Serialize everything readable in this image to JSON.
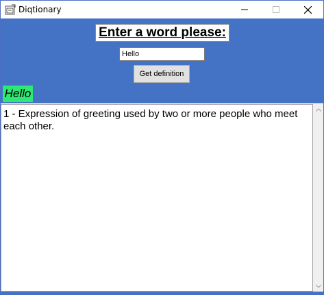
{
  "window": {
    "title": "Diqtionary",
    "icon": "app-icon"
  },
  "header": {
    "heading": "Enter a word please:"
  },
  "search": {
    "value": "Hello",
    "button_label": "Get definition"
  },
  "result": {
    "word": "Hello",
    "definition": "1 - Expression of greeting used by two or more people who meet each other."
  },
  "colors": {
    "accent_blue": "#4472c4",
    "word_highlight": "#2ee875"
  }
}
